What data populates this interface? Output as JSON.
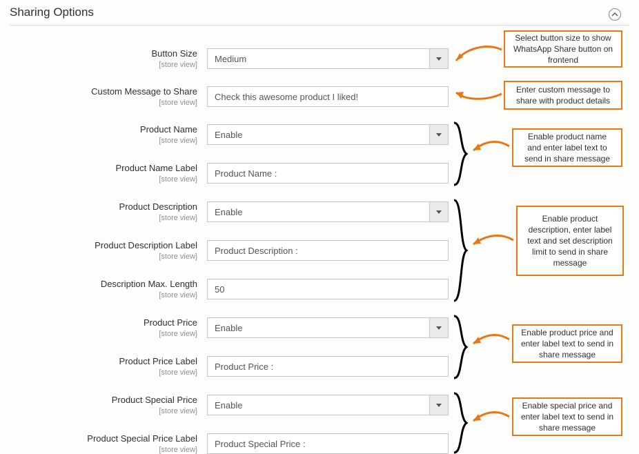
{
  "section": {
    "title": "Sharing Options"
  },
  "scope_text": "[store view]",
  "fields": {
    "button_size": {
      "label": "Button Size",
      "value": "Medium"
    },
    "custom_message": {
      "label": "Custom Message to Share",
      "value": "Check this awesome product I liked!"
    },
    "product_name": {
      "label": "Product Name",
      "value": "Enable"
    },
    "product_name_label": {
      "label": "Product Name Label",
      "value": "Product Name :"
    },
    "product_description": {
      "label": "Product Description",
      "value": "Enable"
    },
    "product_description_label": {
      "label": "Product Description Label",
      "value": "Product Description :"
    },
    "description_max_length": {
      "label": "Description Max. Length",
      "value": "50"
    },
    "product_price": {
      "label": "Product Price",
      "value": "Enable"
    },
    "product_price_label": {
      "label": "Product Price Label",
      "value": "Product Price :"
    },
    "product_special_price": {
      "label": "Product Special Price",
      "value": "Enable"
    },
    "product_special_price_label": {
      "label": "Product Special Price Label",
      "value": "Product Special Price :"
    }
  },
  "callouts": {
    "button_size": "Select button size to show WhatsApp Share button on frontend",
    "custom_message": "Enter custom message to share with product details",
    "product_name": "Enable product name and enter label text to send in share message",
    "product_description": "Enable product description, enter label text and set description limit to send in share message",
    "product_price": "Enable product price and enter label text to send in share message",
    "product_special_price": "Enable special price and enter label text to send in share message"
  }
}
